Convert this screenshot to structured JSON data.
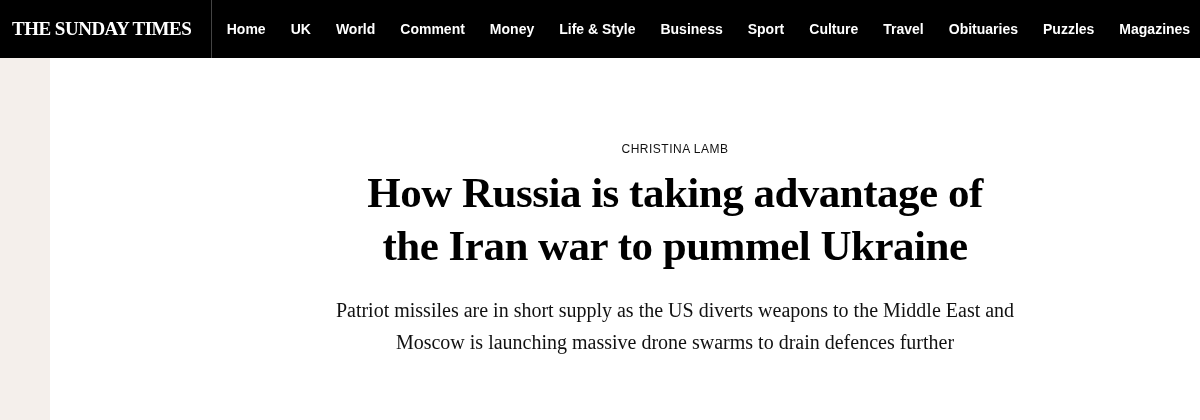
{
  "logo": "THE SUNDAY TIMES",
  "nav": [
    {
      "label": "Home"
    },
    {
      "label": "UK"
    },
    {
      "label": "World"
    },
    {
      "label": "Comment"
    },
    {
      "label": "Money"
    },
    {
      "label": "Life & Style"
    },
    {
      "label": "Business"
    },
    {
      "label": "Sport"
    },
    {
      "label": "Culture"
    },
    {
      "label": "Travel"
    },
    {
      "label": "Obituaries"
    },
    {
      "label": "Puzzles"
    },
    {
      "label": "Magazines"
    }
  ],
  "article": {
    "byline": "CHRISTINA LAMB",
    "headline": "How Russia is taking advantage of the Iran war to pummel Ukraine",
    "standfirst": "Patriot missiles are in short supply as the US diverts weapons to the Middle East and Moscow is launching massive drone swarms to drain defences further"
  }
}
